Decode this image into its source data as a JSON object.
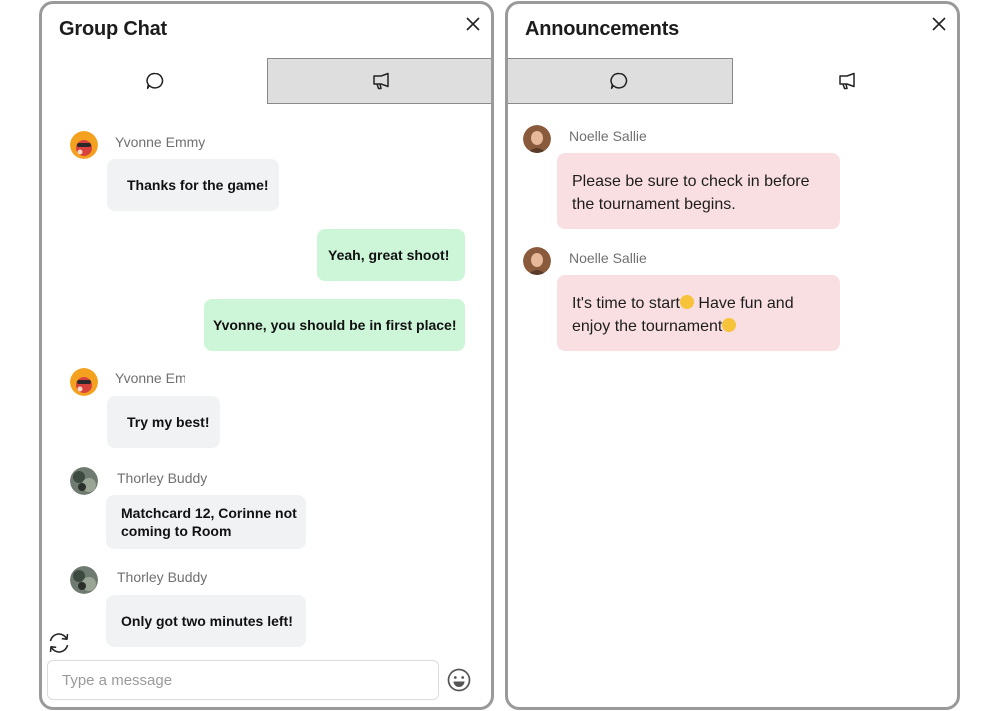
{
  "group_chat": {
    "title": "Group Chat",
    "tabs": [
      {
        "icon": "chat-bubble-icon",
        "active": true
      },
      {
        "icon": "megaphone-icon",
        "active": false
      }
    ],
    "messages": [
      {
        "sender": "Yvonne Emmy",
        "avatar": "avatar-yvonne",
        "direction": "incoming",
        "text": "Thanks for the game!"
      },
      {
        "sender": "",
        "direction": "outgoing",
        "text": "Yeah, great shoot!"
      },
      {
        "sender": "",
        "direction": "outgoing",
        "text": "Yvonne, you should be in first place!"
      },
      {
        "sender": "Yvonne Emmy",
        "avatar": "avatar-yvonne",
        "direction": "incoming",
        "text": "Try my best!"
      },
      {
        "sender": "Thorley Buddy",
        "avatar": "avatar-thorley",
        "direction": "incoming",
        "text": "Matchcard 12, Corinne not coming to Room"
      },
      {
        "sender": "Thorley Buddy",
        "avatar": "avatar-thorley",
        "direction": "incoming",
        "text": "Only got two minutes left!"
      }
    ],
    "input_placeholder": "Type a message"
  },
  "announcements": {
    "title": "Announcements",
    "tabs": [
      {
        "icon": "chat-bubble-icon",
        "active": false
      },
      {
        "icon": "megaphone-icon",
        "active": true
      }
    ],
    "messages": [
      {
        "sender": "Noelle Sallie",
        "avatar": "avatar-noelle",
        "text_lines": [
          "Please be sure to check in before",
          "the tournament begins."
        ]
      },
      {
        "sender": "Noelle Sallie",
        "avatar": "avatar-noelle",
        "text_line1_before_emoji": "It's time to start",
        "emoji1": "smirk-emoji",
        "text_line1_after_emoji": " Have fun and",
        "text_line2": "enjoy the tournament",
        "emoji2": "hugging-emoji"
      }
    ]
  },
  "colors": {
    "panel_border": "#9a9a9a",
    "outgoing_bubble": "#cdf6d8",
    "incoming_bubble": "#f1f2f4",
    "announcement_bubble": "#fadfe2",
    "inactive_tab": "#dedede"
  }
}
